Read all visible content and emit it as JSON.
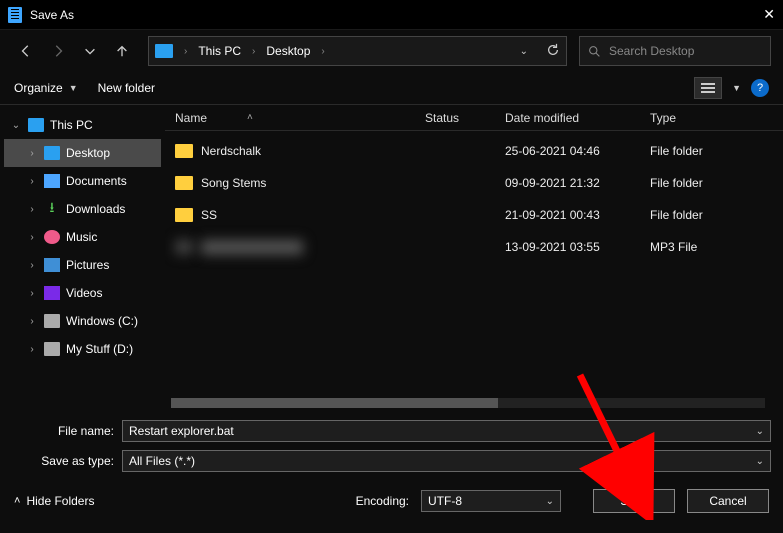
{
  "title": "Save As",
  "breadcrumb": {
    "root": "This PC",
    "child": "Desktop"
  },
  "search": {
    "placeholder": "Search Desktop"
  },
  "toolbar": {
    "organize": "Organize",
    "newfolder": "New folder"
  },
  "tree": {
    "root": "This PC",
    "items": [
      {
        "label": "Desktop"
      },
      {
        "label": "Documents"
      },
      {
        "label": "Downloads"
      },
      {
        "label": "Music"
      },
      {
        "label": "Pictures"
      },
      {
        "label": "Videos"
      },
      {
        "label": "Windows (C:)"
      },
      {
        "label": "My Stuff (D:)"
      }
    ]
  },
  "columns": {
    "name": "Name",
    "status": "Status",
    "date": "Date modified",
    "type": "Type"
  },
  "files": [
    {
      "name": "Nerdschalk",
      "date": "25-06-2021 04:46",
      "type": "File folder"
    },
    {
      "name": "Song Stems",
      "date": "09-09-2021 21:32",
      "type": "File folder"
    },
    {
      "name": "SS",
      "date": "21-09-2021 00:43",
      "type": "File folder"
    },
    {
      "name": "redacted",
      "date": "13-09-2021 03:55",
      "type": "MP3 File"
    }
  ],
  "fields": {
    "filename_label": "File name:",
    "filename_value": "Restart explorer.bat",
    "saveastype_label": "Save as type:",
    "saveastype_value": "All Files  (*.*)"
  },
  "footer": {
    "hidefolders": "Hide Folders",
    "encoding_label": "Encoding:",
    "encoding_value": "UTF-8",
    "save": "Save",
    "cancel": "Cancel"
  }
}
